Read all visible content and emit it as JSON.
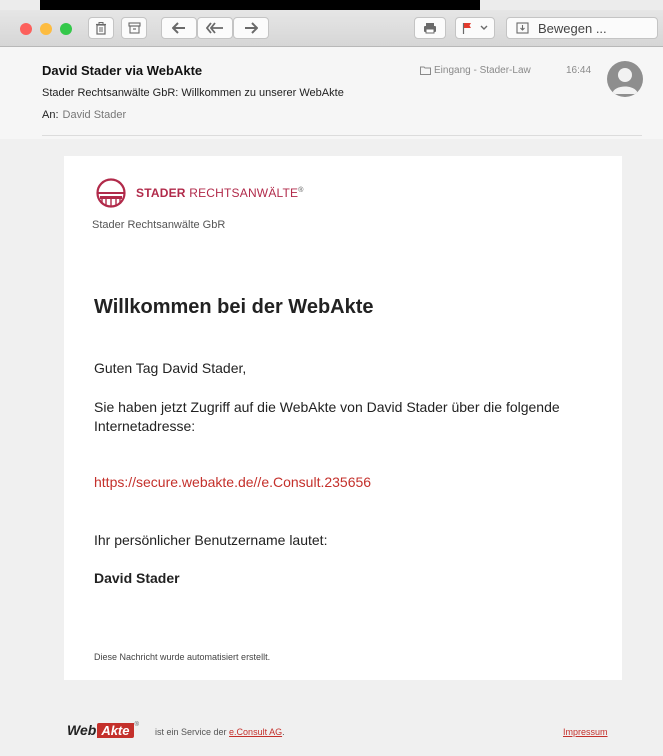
{
  "toolbar": {
    "move_label": "Bewegen ...",
    "icons": [
      "trash-icon",
      "archive-icon",
      "reply-icon",
      "reply-all-icon",
      "forward-icon",
      "print-icon",
      "flag-icon",
      "move-icon"
    ]
  },
  "header": {
    "sender": "David Stader via WebAkte",
    "subject": "Stader Rechtsanwälte GbR: Willkommen zu unserer WebAkte",
    "to_label": "An:",
    "to_value": "David Stader",
    "mailbox": "Eingang - Stader-Law",
    "time": "16:44"
  },
  "email": {
    "brand_bold": "STADER",
    "brand_rest": "RECHTSANWÄLTE",
    "brand_reg": "®",
    "company": "Stader Rechtsanwälte GbR",
    "heading": "Willkommen bei der WebAkte",
    "greeting": "Guten Tag David Stader,",
    "paragraph": "Sie haben jetzt Zugriff auf die WebAkte von David Stader über die folgende Internetadresse:",
    "link": "https://secure.webakte.de//e.Consult.235656",
    "username_label": "Ihr persönlicher Benutzername lautet:",
    "username": "David Stader",
    "auto_note": "Diese Nachricht wurde automatisiert erstellt."
  },
  "footer": {
    "logo_web": "Web",
    "logo_akte": "Akte",
    "logo_reg": "®",
    "service_prefix": "ist ein Service der",
    "service_link": "e.Consult AG",
    "service_suffix": ".",
    "impressum": "Impressum"
  },
  "colors": {
    "accent": "#c4302b",
    "brand": "#b12a4a",
    "close": "#fc605c",
    "minimize": "#fdbc40",
    "zoom": "#34c84a"
  }
}
